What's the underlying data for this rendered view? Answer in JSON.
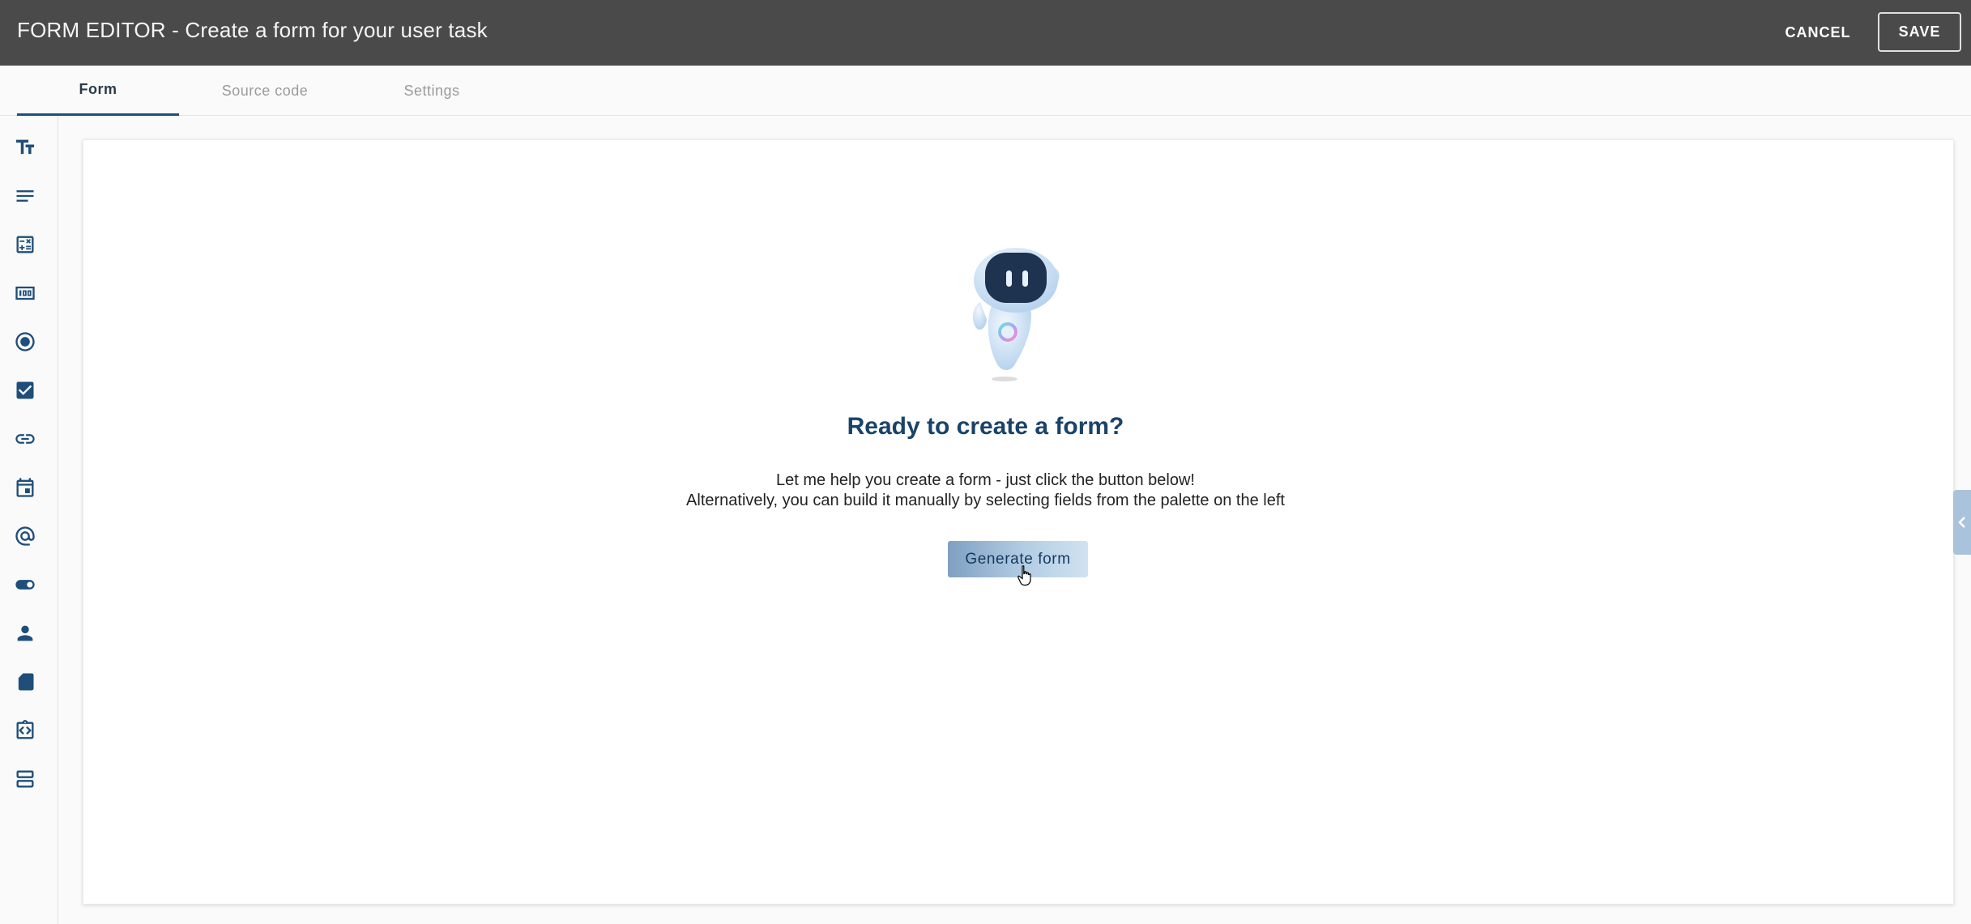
{
  "header": {
    "title": "FORM EDITOR - Create a form for your user task",
    "cancel_label": "CANCEL",
    "save_label": "SAVE"
  },
  "tabs": [
    {
      "label": "Form",
      "active": true
    },
    {
      "label": "Source code",
      "active": false
    },
    {
      "label": "Settings",
      "active": false
    }
  ],
  "palette": {
    "items": [
      "text-size-icon",
      "paragraph-icon",
      "calculator-icon",
      "number-icon",
      "radio-icon",
      "checkbox-icon",
      "link-icon",
      "calendar-icon",
      "at-sign-icon",
      "toggle-icon",
      "person-icon",
      "file-icon",
      "code-icon",
      "section-icon"
    ]
  },
  "empty_state": {
    "title": "Ready to create a form?",
    "line1": "Let me help you create a form - just click the button below!",
    "line2": "Alternatively, you can build it manually by selecting fields from the palette on the left",
    "button_label": "Generate form"
  },
  "colors": {
    "header_bg": "#4a4a4a",
    "accent": "#1f4e7a",
    "title_blue": "#1a4369"
  }
}
